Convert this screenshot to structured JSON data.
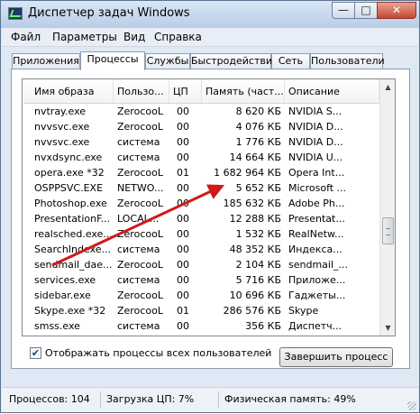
{
  "window": {
    "title": "Диспетчер задач Windows",
    "min_glyph": "—",
    "max_glyph": "□",
    "close_glyph": "✕"
  },
  "menu": [
    "Файл",
    "Параметры",
    "Вид",
    "Справка"
  ],
  "tabs": [
    "Приложения",
    "Процессы",
    "Службы",
    "Быстродействие",
    "Сеть",
    "Пользователи"
  ],
  "active_tab": "Процессы",
  "columns": [
    "Имя образа",
    "Пользо...",
    "ЦП",
    "Память (част...",
    "Описание"
  ],
  "processes": [
    {
      "name": "nvtray.exe",
      "user": "ZerocooL",
      "cpu": "00",
      "mem": "8 620 КБ",
      "desc": "NVIDIA S..."
    },
    {
      "name": "nvvsvc.exe",
      "user": "ZerocooL",
      "cpu": "00",
      "mem": "4 076 КБ",
      "desc": "NVIDIA D..."
    },
    {
      "name": "nvvsvc.exe",
      "user": "система",
      "cpu": "00",
      "mem": "1 776 КБ",
      "desc": "NVIDIA D..."
    },
    {
      "name": "nvxdsync.exe",
      "user": "система",
      "cpu": "00",
      "mem": "14 664 КБ",
      "desc": "NVIDIA U..."
    },
    {
      "name": "opera.exe *32",
      "user": "ZerocooL",
      "cpu": "01",
      "mem": "1 682 964 КБ",
      "desc": "Opera Int..."
    },
    {
      "name": "OSPPSVC.EXE",
      "user": "NETWO...",
      "cpu": "00",
      "mem": "5 652 КБ",
      "desc": "Microsoft ..."
    },
    {
      "name": "Photoshop.exe",
      "user": "ZerocooL",
      "cpu": "00",
      "mem": "185 632 КБ",
      "desc": "Adobe Ph..."
    },
    {
      "name": "PresentationF...",
      "user": "LOCAL...",
      "cpu": "00",
      "mem": "12 288 КБ",
      "desc": "Presentat..."
    },
    {
      "name": "realsched.exe...",
      "user": "ZerocooL",
      "cpu": "00",
      "mem": "1 532 КБ",
      "desc": "RealNetw..."
    },
    {
      "name": "SearchIndexe...",
      "user": "система",
      "cpu": "00",
      "mem": "48 352 КБ",
      "desc": "Индекса..."
    },
    {
      "name": "sendmail_dae...",
      "user": "ZerocooL",
      "cpu": "00",
      "mem": "2 104 КБ",
      "desc": "sendmail_..."
    },
    {
      "name": "services.exe",
      "user": "система",
      "cpu": "00",
      "mem": "5 716 КБ",
      "desc": "Приложе..."
    },
    {
      "name": "sidebar.exe",
      "user": "ZerocooL",
      "cpu": "00",
      "mem": "10 696 КБ",
      "desc": "Гаджеты..."
    },
    {
      "name": "Skype.exe *32",
      "user": "ZerocooL",
      "cpu": "01",
      "mem": "286 576 КБ",
      "desc": "Skype"
    },
    {
      "name": "smss.exe",
      "user": "система",
      "cpu": "00",
      "mem": "356 КБ",
      "desc": "Диспетч..."
    }
  ],
  "show_all_users": {
    "label": "Отображать процессы всех пользователей",
    "checked": true,
    "check_glyph": "✔"
  },
  "end_process_button": "Завершить процесс",
  "scroll": {
    "up": "▲",
    "down": "▼"
  },
  "status": {
    "processes": "Процессов: 104",
    "cpu": "Загрузка ЦП: 7%",
    "memory": "Физическая память: 49%"
  },
  "colors": {
    "annotation_arrow": "#d01a1a"
  }
}
